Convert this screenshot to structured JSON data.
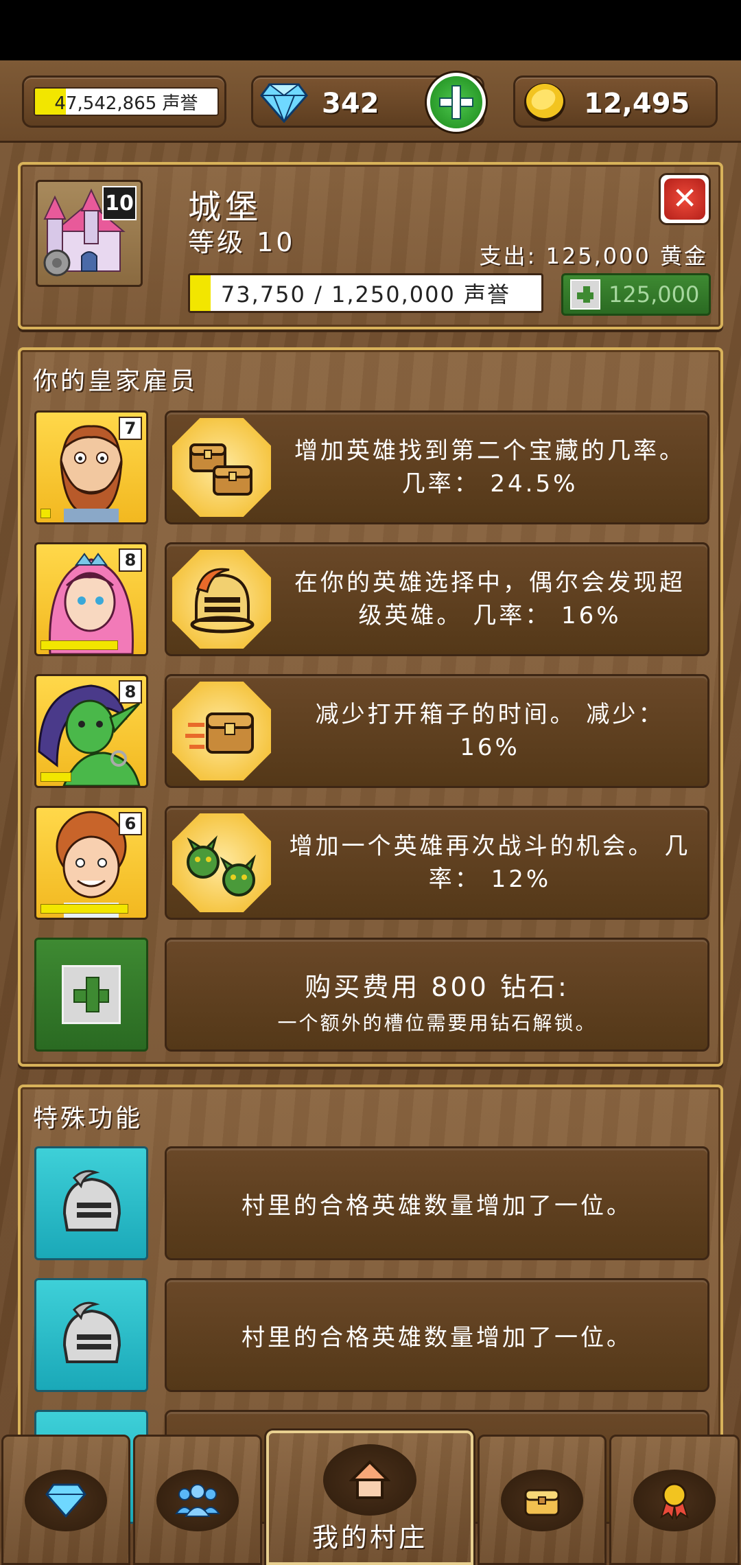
{
  "top_bar": {
    "reputation": {
      "text": "47,542,865 声誉",
      "fill_fraction": 0.17
    },
    "gems": {
      "value": "342",
      "icon": "diamond-icon",
      "add_icon": "plus-icon"
    },
    "gold": {
      "value": "12,495",
      "icon": "gold-coin-icon"
    }
  },
  "building": {
    "name": "城堡",
    "level_text": "等级 10",
    "level_badge": "10",
    "cost_text": "支出: 125,000 黄金",
    "progress_text": "73,750 / 1,250,000 声誉",
    "progress_fraction": 0.059,
    "upgrade_value": "125,000",
    "close_label": "✕"
  },
  "employees": {
    "title": "你的皇家雇员",
    "items": [
      {
        "level": "7",
        "text": "增加英雄找到第二个宝藏的几率。 几率： 24.5%",
        "icon": "double-chest-icon",
        "portrait": "bearded-man-portrait",
        "xp_fraction": 0.1
      },
      {
        "level": "8",
        "text": "在你的英雄选择中，偶尔会发现超级英雄。 几率： 16%",
        "icon": "hero-helmet-icon",
        "portrait": "elf-woman-portrait",
        "xp_fraction": 0.75
      },
      {
        "level": "8",
        "text": "减少打开箱子的时间。 减少： 16%",
        "icon": "fast-chest-icon",
        "portrait": "goblin-woman-portrait",
        "xp_fraction": 0.3
      },
      {
        "level": "6",
        "text": "增加一个英雄再次战斗的机会。 几率： 12%",
        "icon": "goblin-heads-icon",
        "portrait": "curly-boy-portrait",
        "xp_fraction": 0.85
      }
    ],
    "buy_slot": {
      "title": "购买费用 800 钻石:",
      "subtitle": "一个额外的槽位需要用钻石解锁。"
    }
  },
  "features": {
    "title": "特殊功能",
    "items": [
      {
        "text": "村里的合格英雄数量增加了一位。",
        "icon": "knight-helmet-icon"
      },
      {
        "text": "村里的合格英雄数量增加了一位。",
        "icon": "knight-helmet-icon"
      }
    ]
  },
  "bottom_nav": {
    "tabs": [
      {
        "icon": "diamond-icon"
      },
      {
        "icon": "people-icon"
      },
      {
        "icon": "house-icon",
        "label": "我的村庄",
        "active": true
      },
      {
        "icon": "chest-icon"
      },
      {
        "icon": "medal-icon"
      }
    ]
  },
  "colors": {
    "wood": "#7a5634",
    "gold_border": "#d8b25a",
    "green": "#3e8a32",
    "teal": "#1aa8b8",
    "yellow": "#f2e600"
  }
}
